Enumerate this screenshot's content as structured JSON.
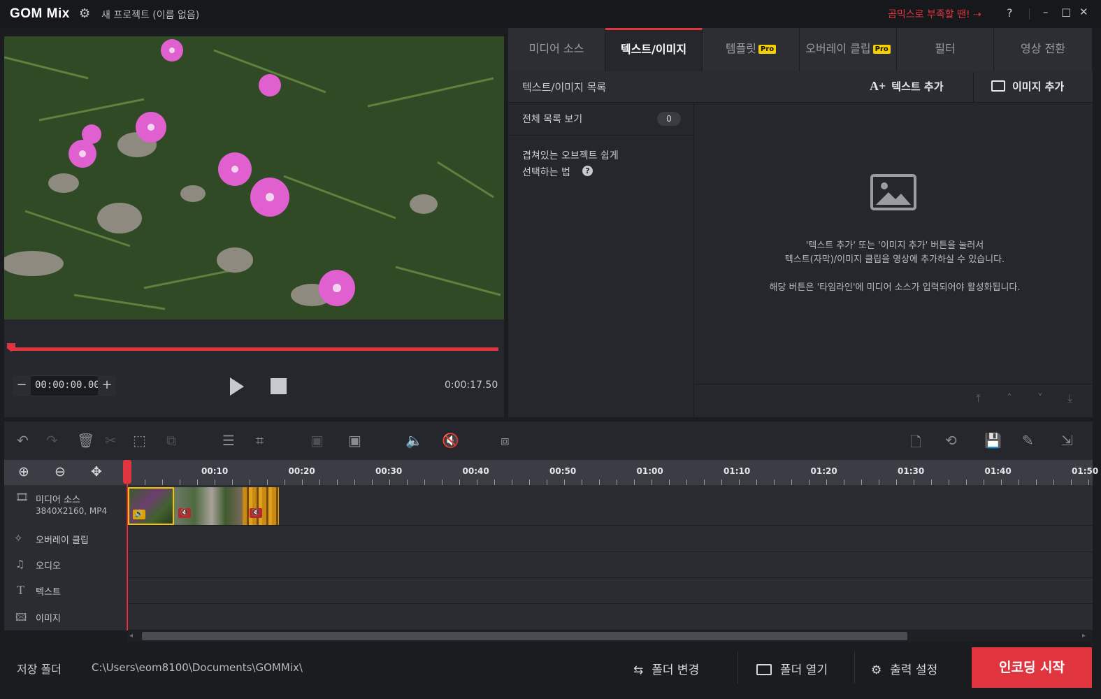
{
  "app": {
    "logo": "GOM Mix",
    "project_title": "새 프로젝트 (이름 없음)",
    "promo_link": "곰믹스로 부족할 땐! ⇢",
    "help": "?",
    "minimize": "–",
    "maximize": "□",
    "close": "✕"
  },
  "preview": {
    "timecode": "00:00:00.00",
    "duration": "0:00:17.50",
    "tc_minus": "−",
    "tc_plus": "+",
    "playback_progress": 0.0
  },
  "tabs": [
    {
      "label": "미디어 소스",
      "active": false,
      "pro": false
    },
    {
      "label": "텍스트/이미지",
      "active": true,
      "pro": false
    },
    {
      "label": "템플릿",
      "active": false,
      "pro": true
    },
    {
      "label": "오버레이 클립",
      "active": false,
      "pro": true
    },
    {
      "label": "필터",
      "active": false,
      "pro": false
    },
    {
      "label": "영상 전환",
      "active": false,
      "pro": false
    }
  ],
  "pro_badge": "Pro",
  "panel": {
    "list_title": "텍스트/이미지 목록",
    "add_text": "텍스트 추가",
    "add_image": "이미지 추가",
    "view_all": "전체 목록 보기",
    "count": "0",
    "tip_line1": "겹쳐있는 오브젝트 쉽게",
    "tip_line2": "선택하는 법",
    "msg1": "'텍스트 추가' 또는 '이미지 추가' 버튼을 눌러서",
    "msg2": "텍스트(자막)/이미지 클립을 영상에 추가하실 수 있습니다.",
    "msg3": "해당 버튼은 '타임라인'에 미디어 소스가 입력되어야 활성화됩니다."
  },
  "ruler": {
    "ticks": [
      "00:10",
      "00:20",
      "00:30",
      "00:40",
      "00:50",
      "01:00",
      "01:10",
      "01:20",
      "01:30",
      "01:40",
      "01:50"
    ]
  },
  "tracks": [
    {
      "name": "미디어 소스",
      "sub": "3840X2160, MP4",
      "icon": "film-icon"
    },
    {
      "name": "오버레이 클립",
      "icon": "magic-wand-icon"
    },
    {
      "name": "오디오",
      "icon": "music-note-icon"
    },
    {
      "name": "텍스트",
      "icon": "text-T-icon"
    },
    {
      "name": "이미지",
      "icon": "image-icon"
    }
  ],
  "bottom": {
    "save_folder_label": "저장 폴더",
    "save_path": "C:\\Users\\eom8100\\Documents\\GOMMix\\",
    "change_folder": "폴더 변경",
    "open_folder": "폴더 열기",
    "output_settings": "출력 설정",
    "encode": "인코딩 시작"
  },
  "colors": {
    "accent": "#e0353f",
    "pro_badge": "#f5d000",
    "clip_selected": "#f5c400"
  }
}
